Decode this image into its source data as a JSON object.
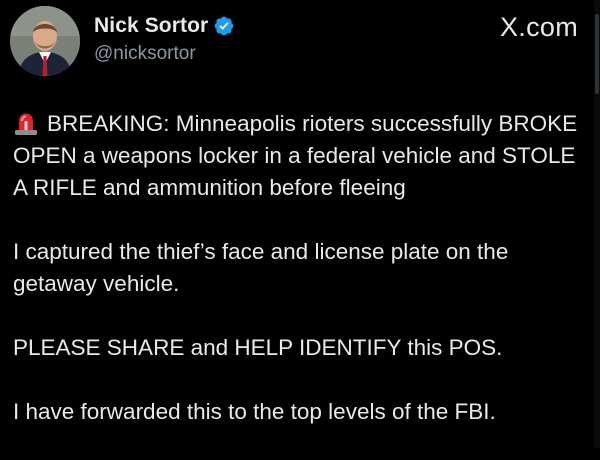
{
  "header": {
    "display_name": "Nick Sortor",
    "handle": "@nicksortor",
    "source_label": "X.com",
    "avatar_icon": "profile-photo",
    "verified_icon": "verified-badge-icon",
    "verified_color": "#1d9bf0"
  },
  "tweet": {
    "siren_icon": "rotating-light-icon",
    "paragraphs": [
      "BREAKING: Minneapolis rioters successfully BROKE OPEN a weapons locker in a federal vehicle and STOLE A RIFLE and ammunition before fleeing",
      "I captured the thief’s face and license plate on the getaway vehicle.",
      "PLEASE SHARE and HELP IDENTIFY this POS.",
      "I have forwarded this to the top levels of the FBI."
    ]
  },
  "colors": {
    "background": "#000000",
    "text_primary": "#e7e9ea",
    "text_secondary": "#8b98a5"
  }
}
